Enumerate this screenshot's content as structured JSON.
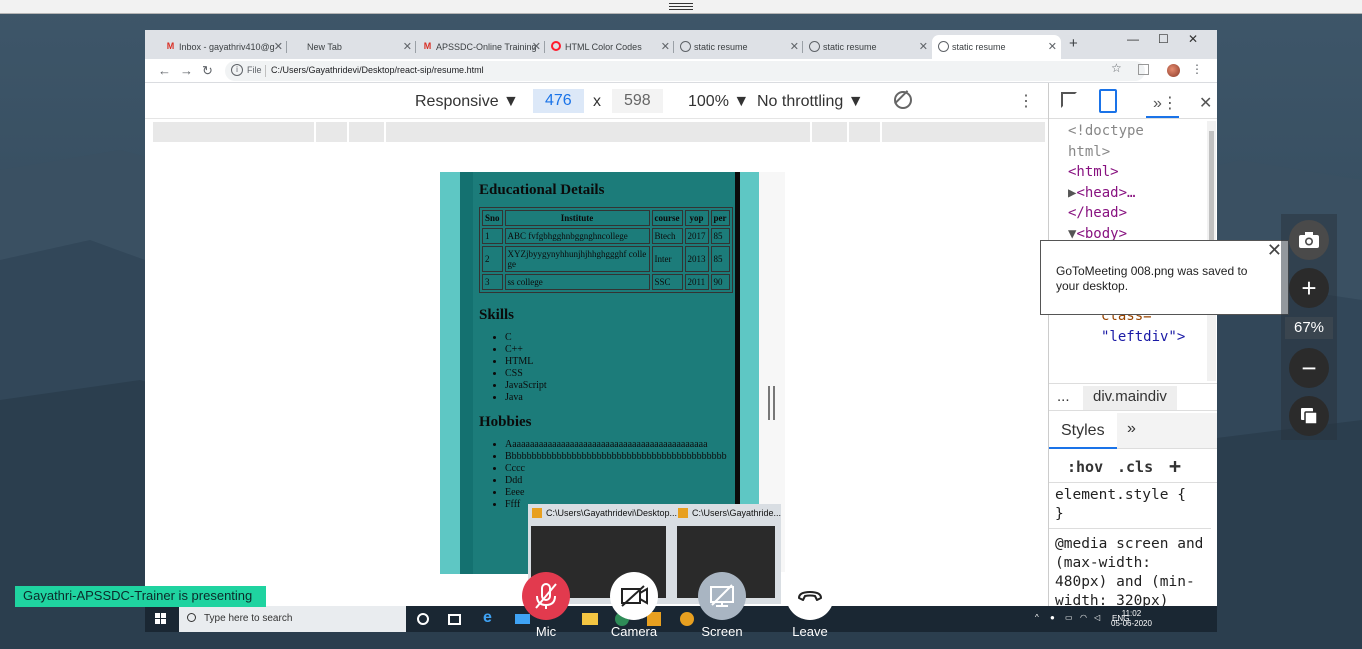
{
  "browser": {
    "tabs": [
      {
        "icon": "gmail-icon",
        "title": "Inbox - gayathriv410@g",
        "active": false
      },
      {
        "icon": "none",
        "title": "New Tab",
        "active": false
      },
      {
        "icon": "gmail-icon",
        "title": "APSSDC-Online Training",
        "active": false
      },
      {
        "icon": "opera-icon",
        "title": "HTML Color Codes",
        "active": false
      },
      {
        "icon": "globe-icon",
        "title": "static resume",
        "active": false
      },
      {
        "icon": "globe-icon",
        "title": "static resume",
        "active": false
      },
      {
        "icon": "globe-icon",
        "title": "static resume",
        "active": true
      }
    ],
    "url_scheme": "File",
    "url": "C:/Users/Gayathridevi/Desktop/react-sip/resume.html"
  },
  "device_toolbar": {
    "mode": "Responsive",
    "width": "476",
    "times": "x",
    "height": "598",
    "zoom": "100%",
    "throttling": "No throttling"
  },
  "resume": {
    "education_heading": "Educational Details",
    "table_headers": [
      "Sno",
      "Institute",
      "course",
      "yop",
      "per"
    ],
    "table_rows": [
      [
        "1",
        "ABC fvfgbhgghnbggnghncollege",
        "Btech",
        "2017",
        "85"
      ],
      [
        "2",
        "XYZjbyygynyhhunjhjhhghggghf college",
        "Inter",
        "2013",
        "85"
      ],
      [
        "3",
        "ss college",
        "SSC",
        "2011",
        "90"
      ]
    ],
    "skills_heading": "Skills",
    "skills": [
      "C",
      "C++",
      "HTML",
      "CSS",
      "JavaScript",
      "Java"
    ],
    "hobbies_heading": "Hobbies",
    "hobbies": [
      "Aaaaaaaaaaaaaaaaaaaaaaaaaaaaaaaaaaaaaaaaaaaaa",
      "Bbbbbbbbbbbbbbbbbbbbbbbbbbbbbbbbbbbbbbbbbbbb",
      "Cccc",
      "Ddd",
      "Eeee",
      "Ffff"
    ]
  },
  "devtools": {
    "dom_lines": [
      "<!doctype",
      "html>",
      "<html>",
      "<head>…",
      "</head>",
      "<body>"
    ],
    "dom_attr_line": "class=",
    "dom_value_line": "\"leftdiv\">",
    "breadcrumb_ellipsis": "...",
    "breadcrumb": "div.maindiv",
    "styles_tab": "Styles",
    "more_tabs": "»",
    "hov": ":hov",
    "cls": ".cls",
    "add": "+",
    "rule1_selector": "element.style {",
    "rule1_close": "}",
    "media_rule": "@media screen and (max-width: 480px) and (min-width: 320px)"
  },
  "toast": {
    "message": "GoToMeeting 008.png was saved to your desktop.",
    "close": "✕"
  },
  "zoom_panel": {
    "level": "67%",
    "plus": "+",
    "minus": "−"
  },
  "taskbar": {
    "search_placeholder": "Type here to search",
    "lang": "ENG",
    "time": "11:02",
    "date": "05-06-2020"
  },
  "thumbnails": [
    {
      "title": "C:\\Users\\Gayathridevi\\Desktop..."
    },
    {
      "title": "C:\\Users\\Gayathride..."
    }
  ],
  "meeting": {
    "presenting": "Gayathri-APSSDC-Trainer is presenting",
    "controls": [
      {
        "label": "Mic",
        "icon": "mic-muted-icon"
      },
      {
        "label": "Camera",
        "icon": "camera-off-icon"
      },
      {
        "label": "Screen",
        "icon": "screen-off-icon"
      },
      {
        "label": "Leave",
        "icon": "phone-hangup-icon"
      }
    ]
  },
  "colors": {
    "resume_bg": "#1c7c7a",
    "resume_side": "#5ec7c4",
    "mic_red": "#e23a4e",
    "presenting_green": "#1fd3a0",
    "devtools_blue": "#1a73e8"
  }
}
